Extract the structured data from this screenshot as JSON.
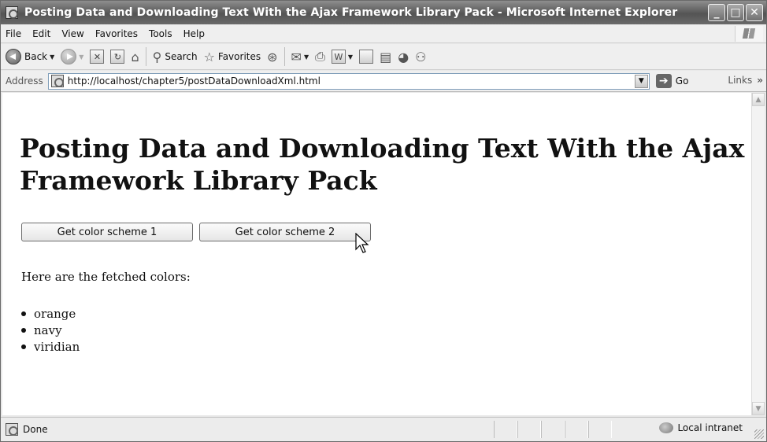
{
  "window": {
    "title": "Posting Data and Downloading Text With the Ajax Framework Library Pack - Microsoft Internet Explorer",
    "controls": [
      "minimize-icon",
      "maximize-icon",
      "close-icon"
    ]
  },
  "menubar": {
    "items": [
      "File",
      "Edit",
      "View",
      "Favorites",
      "Tools",
      "Help"
    ]
  },
  "toolbar": {
    "back_label": "Back",
    "search_label": "Search",
    "favorites_label": "Favorites"
  },
  "addressbar": {
    "label": "Address",
    "url": "http://localhost/chapter5/postDataDownloadXml.html",
    "go_label": "Go",
    "links_label": "Links"
  },
  "page": {
    "heading": "Posting Data and Downloading Text With the Ajax Framework Library Pack",
    "button1": "Get color scheme 1",
    "button2": "Get color scheme 2",
    "fetched_label": "Here are the fetched colors:",
    "colors": [
      "orange",
      "navy",
      "viridian"
    ]
  },
  "statusbar": {
    "text": "Done",
    "zone": "Local intranet"
  }
}
